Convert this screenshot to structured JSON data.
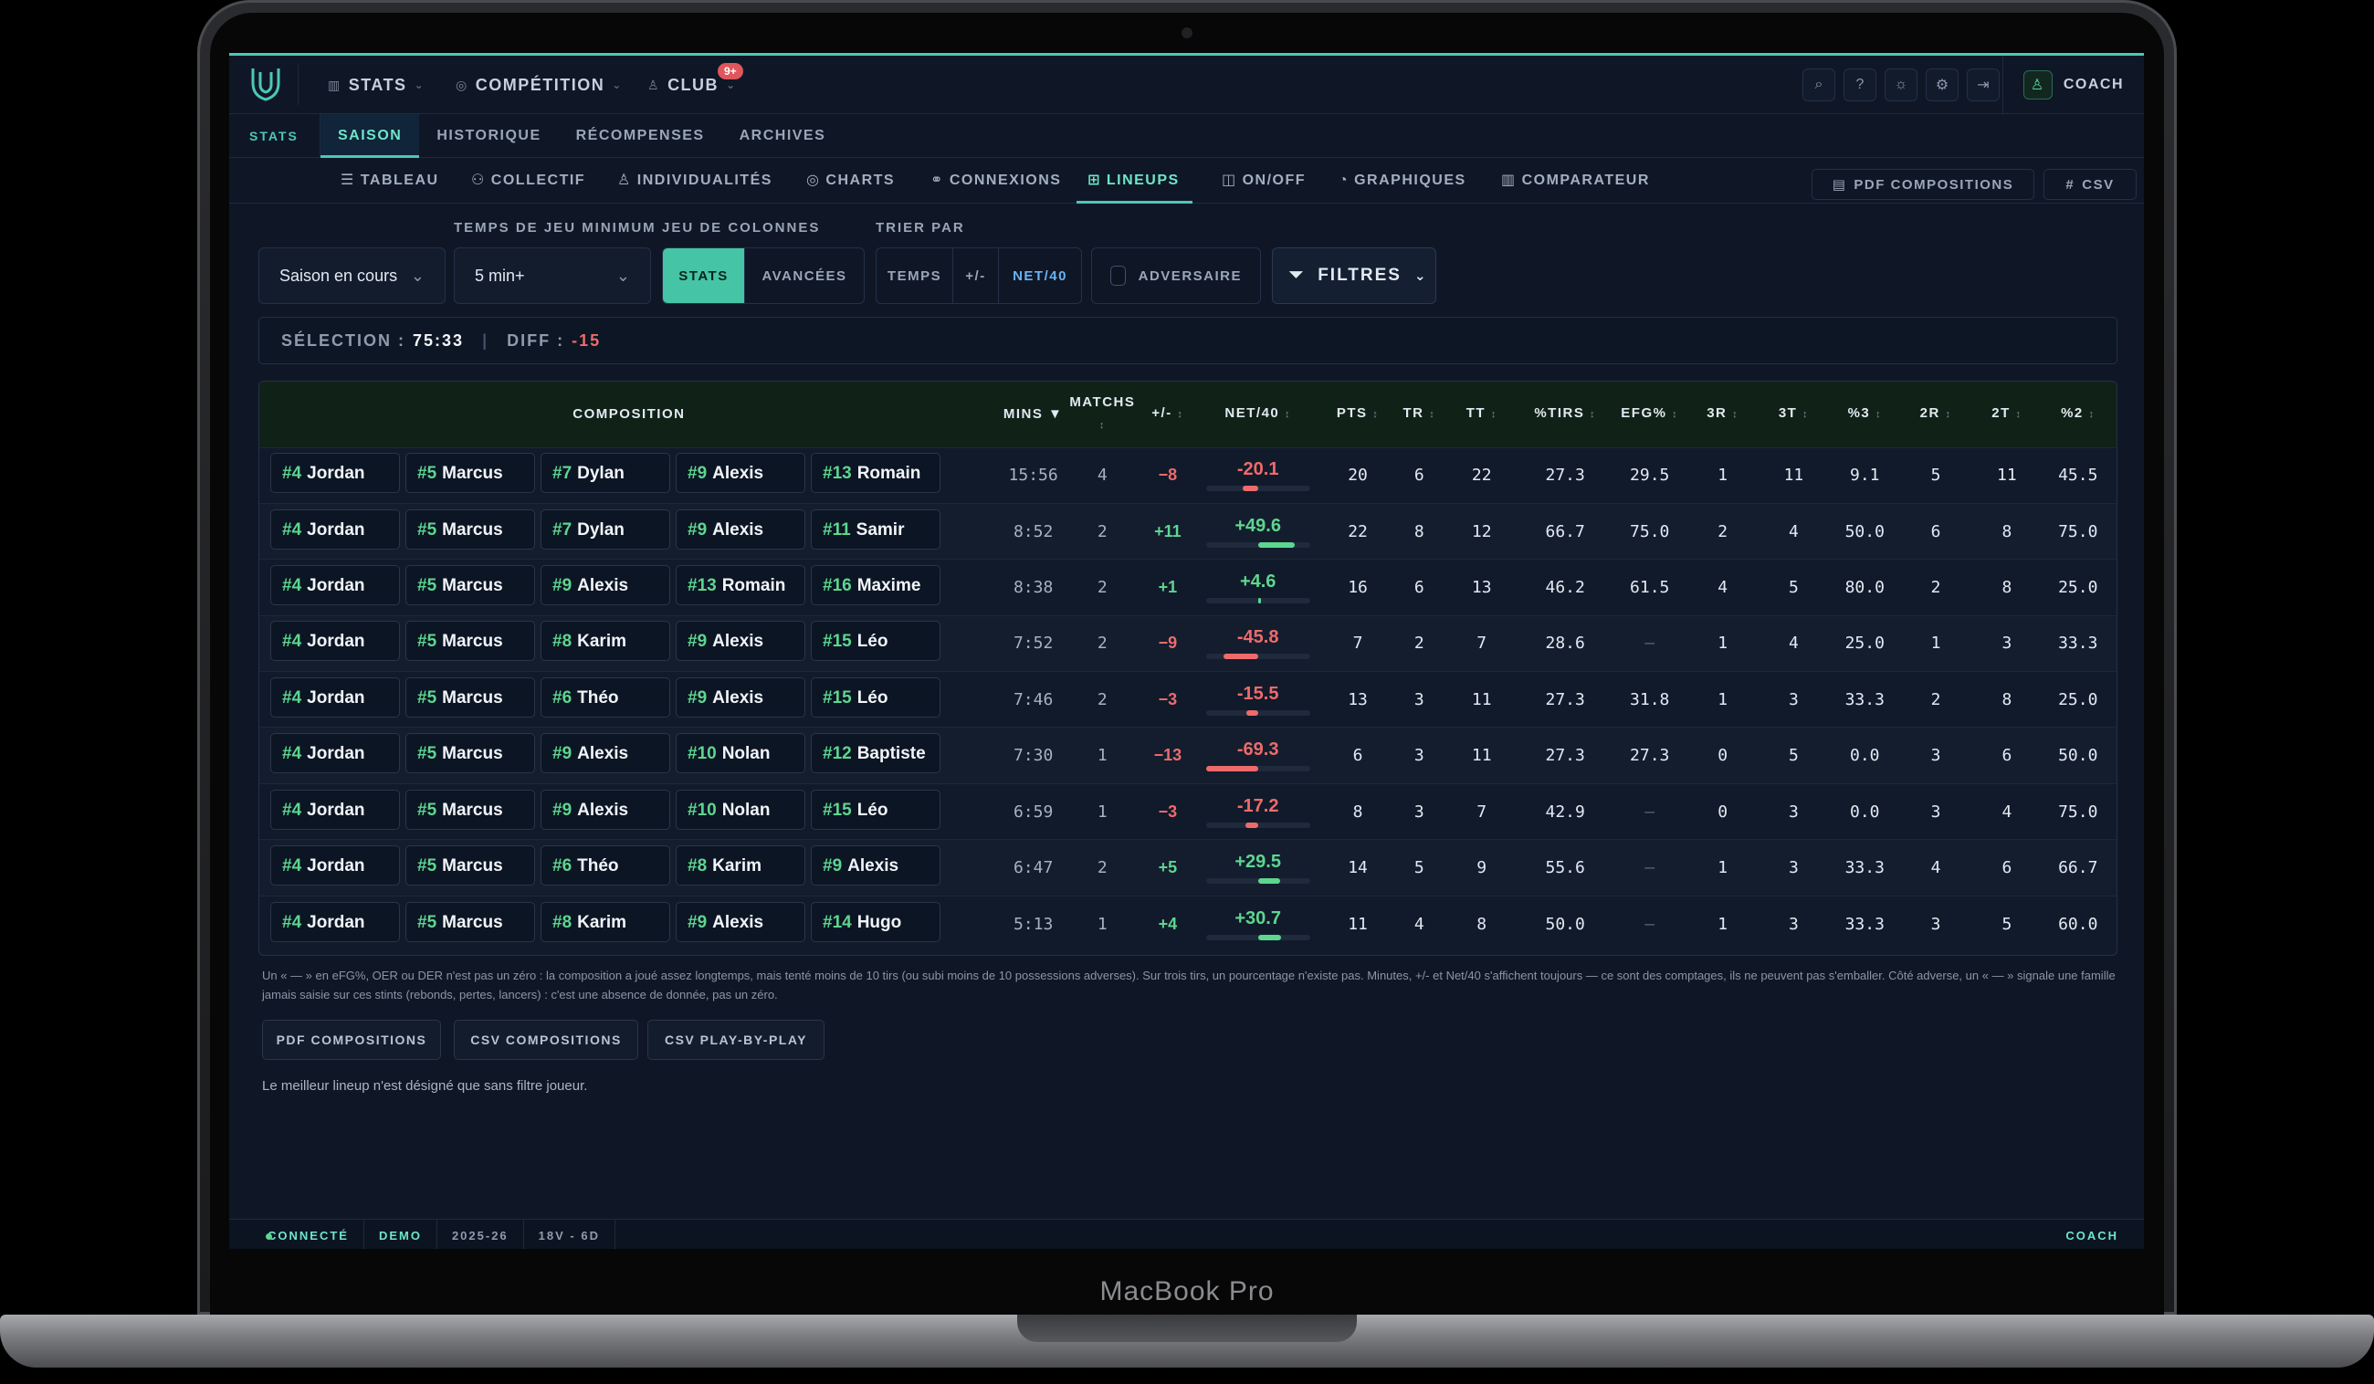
{
  "device": {
    "brand": "MacBook Pro"
  },
  "nav": {
    "items": [
      {
        "label": "STATS",
        "icon": "bar-chart-icon"
      },
      {
        "label": "COMPÉTITION",
        "icon": "target-icon"
      },
      {
        "label": "CLUB",
        "icon": "users-icon",
        "badge": "9+"
      }
    ],
    "user_label": "COACH"
  },
  "subtabs": {
    "section_label": "STATS",
    "items": [
      "SAISON",
      "HISTORIQUE",
      "RÉCOMPENSES",
      "ARCHIVES"
    ],
    "active": "SAISON"
  },
  "views": {
    "items": [
      "TABLEAU",
      "COLLECTIF",
      "INDIVIDUALITÉS",
      "CHARTS",
      "CONNEXIONS",
      "LINEUPS",
      "ON/OFF",
      "GRAPHIQUES",
      "COMPARATEUR"
    ],
    "active": "LINEUPS",
    "pdf_label": "PDF COMPOSITIONS",
    "csv_label": "CSV"
  },
  "filters": {
    "season_value": "Saison en cours",
    "min_time_label": "TEMPS DE JEU MINIMUM",
    "min_time_value": "5 min+",
    "columns_label": "JEU DE COLONNES",
    "columns_options": [
      "STATS",
      "AVANCÉES"
    ],
    "columns_active": "STATS",
    "sort_label": "TRIER PAR",
    "sort_options": [
      "TEMPS",
      "+/-",
      "NET/40"
    ],
    "sort_active": "NET/40",
    "opponent_label": "ADVERSAIRE",
    "filters_button": "FILTRES"
  },
  "selection": {
    "label": "SÉLECTION :",
    "value": "75:33",
    "diff_label": "DIFF :",
    "diff_value": "-15"
  },
  "table": {
    "headers": {
      "composition": "COMPOSITION",
      "mins": "MINS ▼",
      "matchs": "MATCHS",
      "pm": "+/-",
      "net": "NET/40",
      "pts": "PTS",
      "tr": "TR",
      "tt": "TT",
      "ptirs": "%TIRS",
      "efg": "EFG%",
      "r3": "3R",
      "t3": "3T",
      "p3": "%3",
      "r2": "2R",
      "t2": "2T",
      "p2": "%2"
    },
    "rows": [
      {
        "players": [
          [
            "#4",
            "Jordan"
          ],
          [
            "#5",
            "Marcus"
          ],
          [
            "#7",
            "Dylan"
          ],
          [
            "#9",
            "Alexis"
          ],
          [
            "#13",
            "Romain"
          ]
        ],
        "mins": "15:56",
        "matchs": "4",
        "pm": "−8",
        "net": "-20.1",
        "net_value": -20.1,
        "pts": "20",
        "tr": "6",
        "tt": "22",
        "ptirs": "27.3",
        "efg": "29.5",
        "r3": "1",
        "t3": "11",
        "p3": "9.1",
        "r2": "5",
        "t2": "11",
        "p2": "45.5"
      },
      {
        "players": [
          [
            "#4",
            "Jordan"
          ],
          [
            "#5",
            "Marcus"
          ],
          [
            "#7",
            "Dylan"
          ],
          [
            "#9",
            "Alexis"
          ],
          [
            "#11",
            "Samir"
          ]
        ],
        "mins": "8:52",
        "matchs": "2",
        "pm": "+11",
        "net": "+49.6",
        "net_value": 49.6,
        "pts": "22",
        "tr": "8",
        "tt": "12",
        "ptirs": "66.7",
        "efg": "75.0",
        "r3": "2",
        "t3": "4",
        "p3": "50.0",
        "r2": "6",
        "t2": "8",
        "p2": "75.0"
      },
      {
        "players": [
          [
            "#4",
            "Jordan"
          ],
          [
            "#5",
            "Marcus"
          ],
          [
            "#9",
            "Alexis"
          ],
          [
            "#13",
            "Romain"
          ],
          [
            "#16",
            "Maxime"
          ]
        ],
        "mins": "8:38",
        "matchs": "2",
        "pm": "+1",
        "net": "+4.6",
        "net_value": 4.6,
        "pts": "16",
        "tr": "6",
        "tt": "13",
        "ptirs": "46.2",
        "efg": "61.5",
        "r3": "4",
        "t3": "5",
        "p3": "80.0",
        "r2": "2",
        "t2": "8",
        "p2": "25.0"
      },
      {
        "players": [
          [
            "#4",
            "Jordan"
          ],
          [
            "#5",
            "Marcus"
          ],
          [
            "#8",
            "Karim"
          ],
          [
            "#9",
            "Alexis"
          ],
          [
            "#15",
            "Léo"
          ]
        ],
        "mins": "7:52",
        "matchs": "2",
        "pm": "−9",
        "net": "-45.8",
        "net_value": -45.8,
        "pts": "7",
        "tr": "2",
        "tt": "7",
        "ptirs": "28.6",
        "efg": "—",
        "r3": "1",
        "t3": "4",
        "p3": "25.0",
        "r2": "1",
        "t2": "3",
        "p2": "33.3"
      },
      {
        "players": [
          [
            "#4",
            "Jordan"
          ],
          [
            "#5",
            "Marcus"
          ],
          [
            "#6",
            "Théo"
          ],
          [
            "#9",
            "Alexis"
          ],
          [
            "#15",
            "Léo"
          ]
        ],
        "mins": "7:46",
        "matchs": "2",
        "pm": "−3",
        "net": "-15.5",
        "net_value": -15.5,
        "pts": "13",
        "tr": "3",
        "tt": "11",
        "ptirs": "27.3",
        "efg": "31.8",
        "r3": "1",
        "t3": "3",
        "p3": "33.3",
        "r2": "2",
        "t2": "8",
        "p2": "25.0"
      },
      {
        "players": [
          [
            "#4",
            "Jordan"
          ],
          [
            "#5",
            "Marcus"
          ],
          [
            "#9",
            "Alexis"
          ],
          [
            "#10",
            "Nolan"
          ],
          [
            "#12",
            "Baptiste"
          ]
        ],
        "mins": "7:30",
        "matchs": "1",
        "pm": "−13",
        "net": "-69.3",
        "net_value": -69.3,
        "pts": "6",
        "tr": "3",
        "tt": "11",
        "ptirs": "27.3",
        "efg": "27.3",
        "r3": "0",
        "t3": "5",
        "p3": "0.0",
        "r2": "3",
        "t2": "6",
        "p2": "50.0"
      },
      {
        "players": [
          [
            "#4",
            "Jordan"
          ],
          [
            "#5",
            "Marcus"
          ],
          [
            "#9",
            "Alexis"
          ],
          [
            "#10",
            "Nolan"
          ],
          [
            "#15",
            "Léo"
          ]
        ],
        "mins": "6:59",
        "matchs": "1",
        "pm": "−3",
        "net": "-17.2",
        "net_value": -17.2,
        "pts": "8",
        "tr": "3",
        "tt": "7",
        "ptirs": "42.9",
        "efg": "—",
        "r3": "0",
        "t3": "3",
        "p3": "0.0",
        "r2": "3",
        "t2": "4",
        "p2": "75.0"
      },
      {
        "players": [
          [
            "#4",
            "Jordan"
          ],
          [
            "#5",
            "Marcus"
          ],
          [
            "#6",
            "Théo"
          ],
          [
            "#8",
            "Karim"
          ],
          [
            "#9",
            "Alexis"
          ]
        ],
        "mins": "6:47",
        "matchs": "2",
        "pm": "+5",
        "net": "+29.5",
        "net_value": 29.5,
        "pts": "14",
        "tr": "5",
        "tt": "9",
        "ptirs": "55.6",
        "efg": "—",
        "r3": "1",
        "t3": "3",
        "p3": "33.3",
        "r2": "4",
        "t2": "6",
        "p2": "66.7"
      },
      {
        "players": [
          [
            "#4",
            "Jordan"
          ],
          [
            "#5",
            "Marcus"
          ],
          [
            "#8",
            "Karim"
          ],
          [
            "#9",
            "Alexis"
          ],
          [
            "#14",
            "Hugo"
          ]
        ],
        "mins": "5:13",
        "matchs": "1",
        "pm": "+4",
        "net": "+30.7",
        "net_value": 30.7,
        "pts": "11",
        "tr": "4",
        "tt": "8",
        "ptirs": "50.0",
        "efg": "—",
        "r3": "1",
        "t3": "3",
        "p3": "33.3",
        "r2": "3",
        "t2": "5",
        "p2": "60.0"
      }
    ]
  },
  "footnote": "Un « — » en eFG%, OER ou DER n'est pas un zéro : la composition a joué assez longtemps, mais tenté moins de 10 tirs (ou subi moins de 10 possessions adverses). Sur trois tirs, un pourcentage n'existe pas. Minutes, +/- et Net/40 s'affichent toujours — ce sont des comptages, ils ne peuvent pas s'emballer. Côté adverse, un « — » signale une famille jamais saisie sur ces stints (rebonds, pertes, lancers) : c'est une absence de donnée, pas un zéro.",
  "exports": [
    "PDF COMPOSITIONS",
    "CSV COMPOSITIONS",
    "CSV PLAY-BY-PLAY"
  ],
  "note": "Le meilleur lineup n'est désigné que sans filtre joueur.",
  "status": {
    "connection": "CONNECTÉ",
    "mode": "DEMO",
    "season": "2025-26",
    "record": "18V - 6D",
    "role": "COACH"
  },
  "colors": {
    "accent": "#4cc8b4",
    "positive": "#5dd68f",
    "negative": "#ee6b6b",
    "background": "#0f1726"
  }
}
